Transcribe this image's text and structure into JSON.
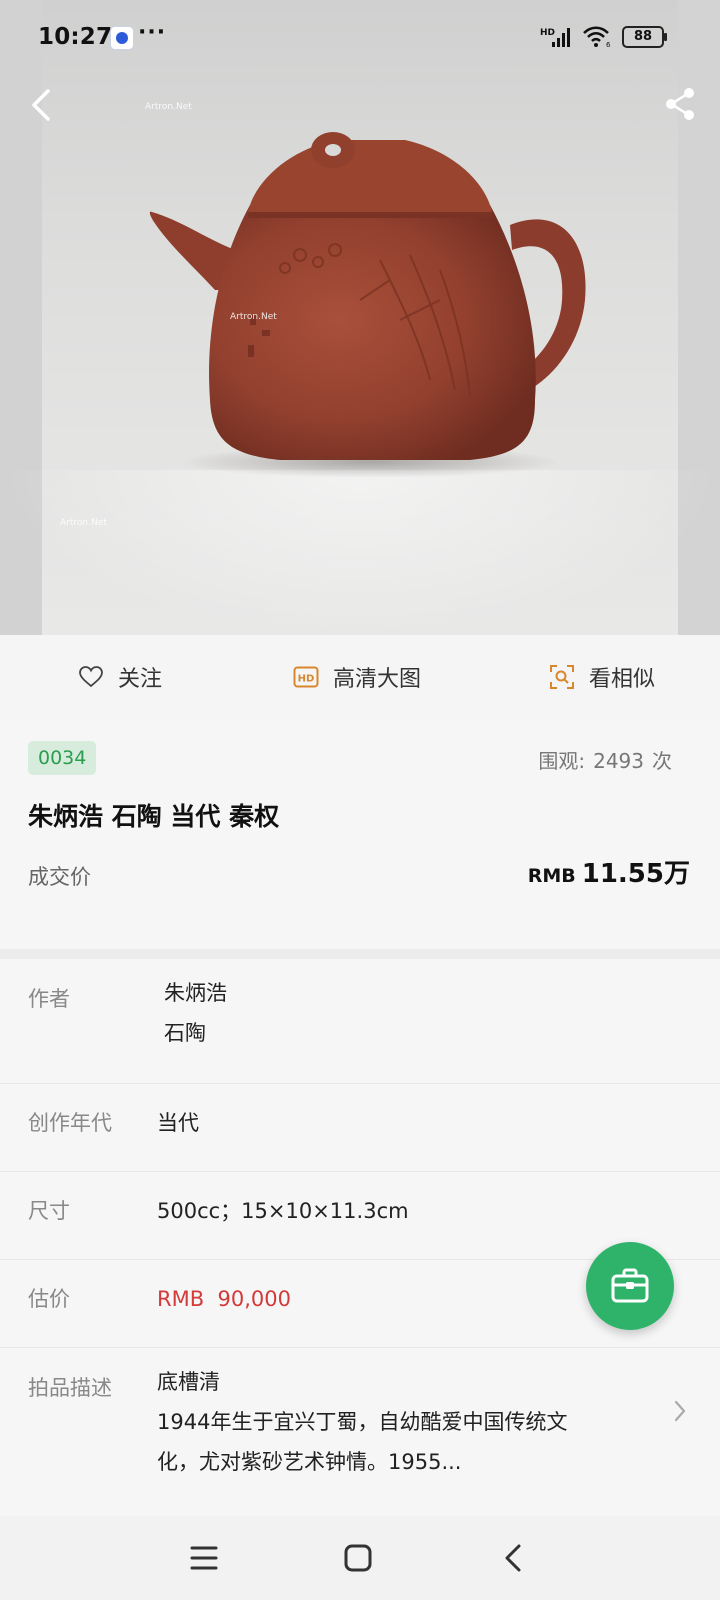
{
  "status_bar": {
    "time": "10:27",
    "more": "···",
    "hd": "HD",
    "wifi_sub": "6",
    "battery": "88"
  },
  "hero": {
    "watermark": "Artron.Net"
  },
  "actions": {
    "follow_label": "关注",
    "hd_label": "高清大图",
    "similar_label": "看相似"
  },
  "lot": {
    "number": "0034",
    "views_label": "围观:",
    "views_count": "2493",
    "views_unit": "次",
    "title": "朱炳浩 石陶 当代 秦权",
    "price_label": "成交价",
    "price_currency": "RMB",
    "price_amount": "11.55万"
  },
  "details": {
    "author_label": "作者",
    "author_values": [
      "朱炳浩",
      "石陶"
    ],
    "era_label": "创作年代",
    "era_value": "当代",
    "size_label": "尺寸",
    "size_value": "500cc；15×10×11.3cm",
    "estimate_label": "估价",
    "estimate_value": "RMB  90,000",
    "desc_label": "拍品描述",
    "desc_lines": [
      "底槽清",
      "1944年生于宜兴丁蜀，自幼酷爱中国传统文",
      "化，尤对紫砂艺术钟情。1955..."
    ]
  },
  "colors": {
    "accent_green": "#2fb36a",
    "badge_bg": "#d7ecdc",
    "badge_text": "#2b9d4e",
    "estimate_red": "#d33b3b",
    "teapot": "#93402f",
    "hd_icon_orange": "#d8872e"
  },
  "icons": {
    "back": "chevron-left-icon",
    "share": "share-icon",
    "follow": "heart-icon",
    "hd": "hd-icon",
    "similar": "scan-search-icon",
    "fab": "briefcase-icon",
    "desc_more": "chevron-right-icon"
  }
}
